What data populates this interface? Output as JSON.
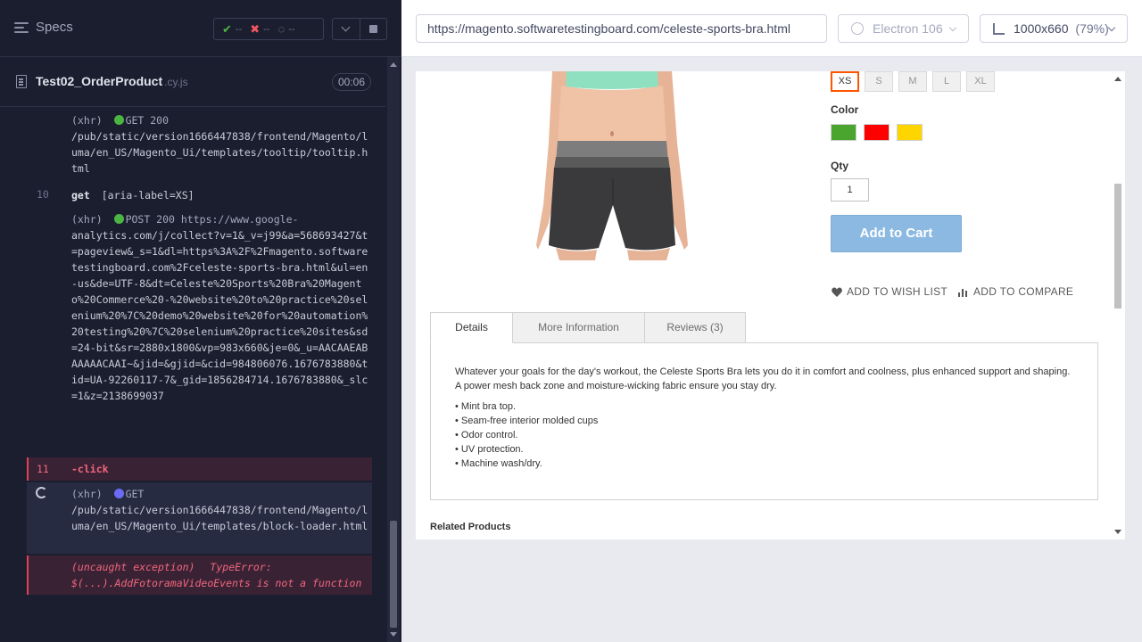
{
  "reporter": {
    "specs_label": "Specs",
    "stats": {
      "passed": "--",
      "failed": "--",
      "pending": "--"
    },
    "spec_name": "Test02_OrderProduct",
    "spec_ext": ".cy.js",
    "duration": "00:06",
    "commands": [
      {
        "type": "xhr",
        "prefix": "(xhr)",
        "method": "GET 200",
        "dot_color": "#4bb543",
        "text": "/pub/static/version1666447838/frontend/Magento/luma/en_US/Magento_Ui/templates/tooltip/tooltip.html"
      },
      {
        "type": "command",
        "number": "10",
        "name": "get",
        "args": "[aria-label=XS]"
      },
      {
        "type": "xhr",
        "prefix": "(xhr)",
        "method": "POST 200 https://www.google-",
        "dot_color": "#4bb543",
        "text": "analytics.com/j/collect?v=1&_v=j99&a=568693427&t=pageview&_s=1&dl=https%3A%2F%2Fmagento.softwaretestingboard.com%2Fceleste-sports-bra.html&ul=en-us&de=UTF-8&dt=Celeste%20Sports%20Bra%20Magento%20Commerce%20-%20website%20to%20practice%20selenium%20%7C%20demo%20website%20for%20automation%20testing%20%7C%20selenium%20practice%20sites&sd=24-bit&sr=2880x1800&vp=983x660&je=0&_u=AACAAEABAAAAACAAI~&jid=&gjid=&cid=984806076.1676783880&tid=UA-92260117-7&_gid=1856284714.1676783880&_slc=1&z=2138699037"
      },
      {
        "type": "failed",
        "number": "11",
        "name": "-click"
      },
      {
        "type": "pending_xhr",
        "prefix": "(xhr)",
        "method": "GET",
        "dot_color": "#6b6bf5",
        "text": "/pub/static/version1666447838/frontend/Magento/luma/en_US/Magento_Ui/templates/block-loader.html"
      },
      {
        "type": "error",
        "label": "(uncaught exception)",
        "error_type": "TypeError:",
        "text": "$(...).AddFotoramaVideoEvents is not a function"
      }
    ]
  },
  "aut": {
    "url": "https://magento.softwaretestingboard.com/celeste-sports-bra.html",
    "browser": "Electron 106",
    "viewport": "1000x660",
    "zoom": "(79%)"
  },
  "product": {
    "sizes": [
      "XS",
      "S",
      "M",
      "L",
      "XL"
    ],
    "selected_size": "XS",
    "color_label": "Color",
    "colors": [
      "#4aa52e",
      "#ff0000",
      "#ffd500"
    ],
    "qty_label": "Qty",
    "qty_value": "1",
    "add_to_cart": "Add to Cart",
    "wishlist": "ADD TO WISH LIST",
    "compare": "ADD TO COMPARE",
    "tabs": [
      "Details",
      "More Information",
      "Reviews (3)"
    ],
    "active_tab": "Details",
    "description": "Whatever your goals for the day's workout, the Celeste Sports Bra lets you do it in comfort and coolness, plus enhanced support and shaping. A power mesh back zone and moisture-wicking fabric ensure you stay dry.",
    "features": [
      "• Mint bra top.",
      "• Seam-free interior molded cups",
      "• Odor control.",
      "• UV protection.",
      "• Machine wash/dry."
    ],
    "related_title": "Related Products"
  }
}
